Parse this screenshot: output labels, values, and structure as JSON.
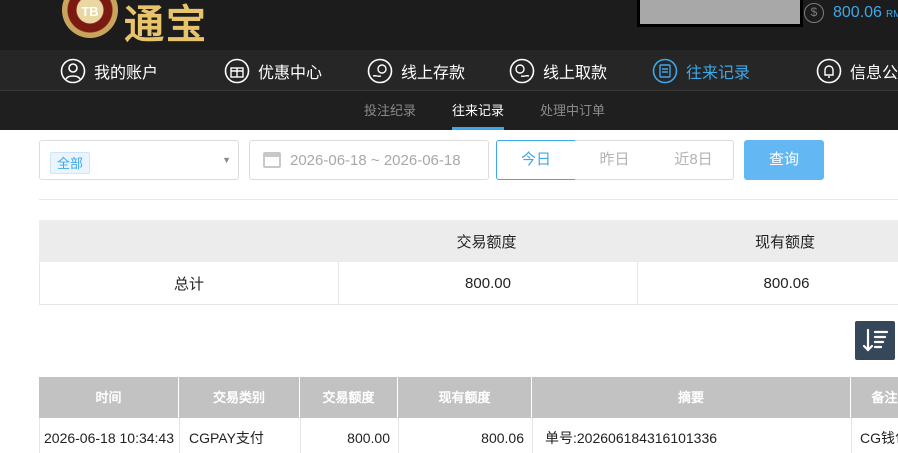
{
  "header": {
    "logo_badge": "TB",
    "logo_text": "通宝",
    "balance": "800.06",
    "currency": "RMB"
  },
  "main_nav": [
    {
      "label": "我的账户",
      "icon": "user-icon"
    },
    {
      "label": "优惠中心",
      "icon": "gift-icon"
    },
    {
      "label": "线上存款",
      "icon": "deposit-icon"
    },
    {
      "label": "线上取款",
      "icon": "withdraw-icon"
    },
    {
      "label": "往来记录",
      "icon": "records-icon",
      "active": true
    },
    {
      "label": "信息公",
      "icon": "bell-icon"
    }
  ],
  "sub_nav": [
    {
      "label": "投注纪录"
    },
    {
      "label": "往来记录",
      "active": true
    },
    {
      "label": "处理中订单"
    }
  ],
  "filters": {
    "type_selected": "全部",
    "date_range": "2026-06-18 ~ 2026-06-18",
    "quick": [
      "今日",
      "昨日",
      "近8日"
    ],
    "query_label": "查询"
  },
  "summary": {
    "headers": [
      "",
      "交易额度",
      "现有额度"
    ],
    "row_label": "总计",
    "trade_amount": "800.00",
    "current_amount": "800.06"
  },
  "records": {
    "headers": [
      "时间",
      "交易类别",
      "交易额度",
      "现有额度",
      "摘要",
      "备注"
    ],
    "rows": [
      [
        "2026-06-18 10:34:43",
        "CGPAY支付",
        "800.00",
        "800.06",
        "单号:202606184316101336",
        "CG钱包"
      ]
    ]
  },
  "colors": {
    "accent": "#3ea7e8",
    "topbar": "#1c1c1c",
    "nav": "#262626",
    "table_header": "#c2c2c2"
  }
}
